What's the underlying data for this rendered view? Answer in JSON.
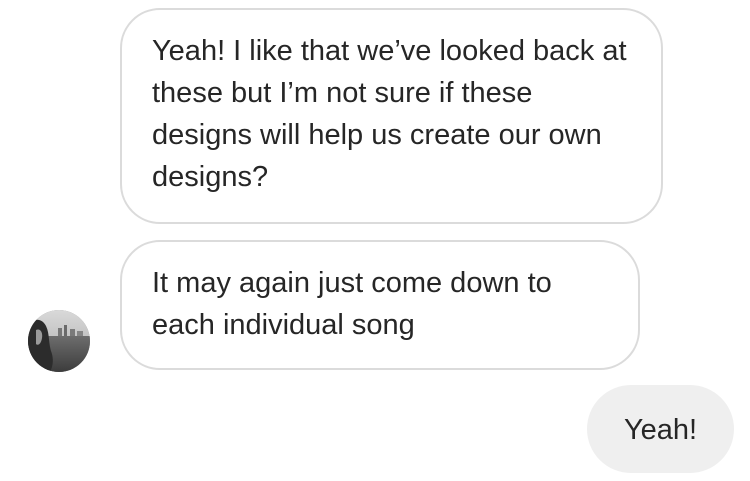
{
  "conversation": {
    "messages": [
      {
        "sender": "other",
        "text": "Yeah! I like that we’ve looked back at these but I’m not sure if these designs will help us create our own designs?"
      },
      {
        "sender": "other",
        "text": "It may again just come down to each individual song"
      },
      {
        "sender": "me",
        "text": "Yeah!"
      }
    ],
    "colors": {
      "incoming_border": "#dbdbdb",
      "outgoing_background": "#efefef",
      "text": "#262626"
    },
    "avatar_icon": "user-photo-avatar"
  }
}
